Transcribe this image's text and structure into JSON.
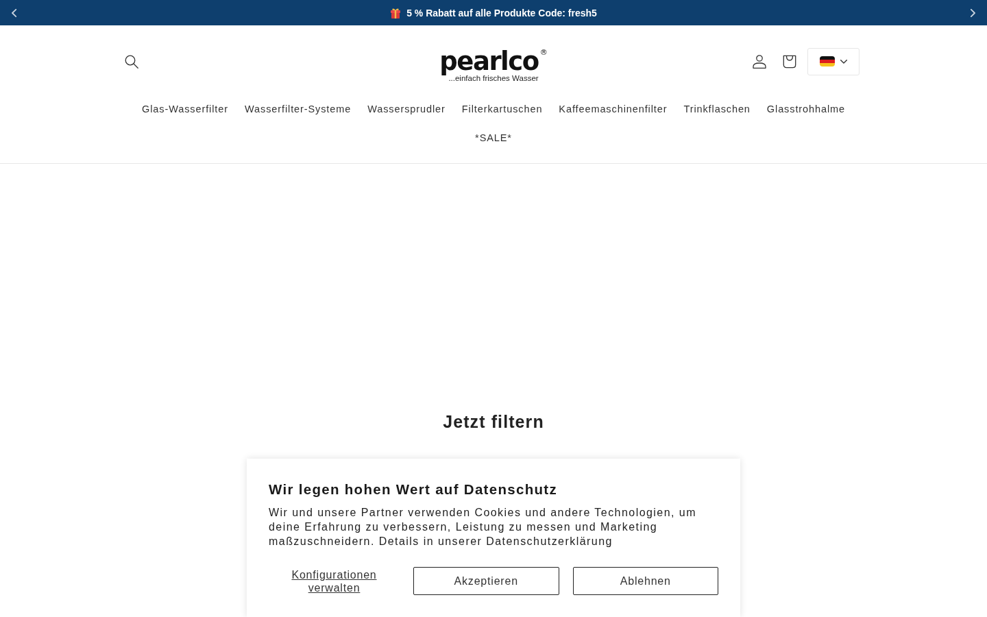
{
  "announcement": {
    "text": "5 % Rabatt auf alle Produkte Code: fresh5"
  },
  "header": {
    "logo": {
      "name": "pearlco$^{®}$",
      "tagline": "...einfach frisches Wasser"
    }
  },
  "nav": [
    "Glas-Wasserfilter",
    "Wasserfilter-Systeme",
    "Wassersprudler",
    "Filterkartuschen",
    "Kaffeemaschinenfilter",
    "Trinkflaschen",
    "Glasstrohhalme",
    "*SALE*"
  ],
  "hero": {
    "title": "Jetzt filtern"
  },
  "cookie_banner": {
    "title": "Wir legen hohen Wert auf Datenschutz",
    "text": "Wir und unsere Partner verwenden Cookies und andere Technologien, um deine Erfahrung zu verbessern, Leistung zu messen und Marketing maßzuschneidern. Details in unserer",
    "link": "Datenschutzerklärung",
    "buttons": [
      {
        "kind": "link",
        "label": "Konfigurationen verwalten"
      },
      {
        "kind": "outline",
        "label": "Akzeptieren"
      },
      {
        "kind": "outline",
        "label": "Ablehnen"
      }
    ]
  }
}
